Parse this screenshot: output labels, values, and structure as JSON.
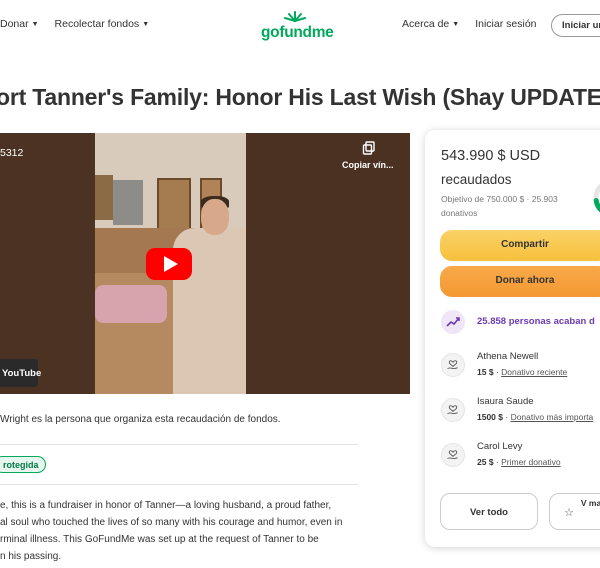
{
  "header": {
    "nav_left": [
      {
        "label": "Donar"
      },
      {
        "label": "Recolectar fondos"
      }
    ],
    "logo_text": "gofundme",
    "nav_right": [
      {
        "label": "Acerca de"
      },
      {
        "label": "Iniciar sesión"
      }
    ],
    "start_button": "Iniciar una"
  },
  "campaign": {
    "title": "ort Tanner's Family: Honor His Last Wish (Shay UPDATE",
    "video": {
      "label": "5312",
      "copy_label": "Copiar vín...",
      "youtube_badge": "YouTube"
    },
    "organizer_text": "Wright es la persona que organiza esta recaudación de fondos.",
    "protected_badge": "rotegida",
    "description": [
      "e, this is a fundraiser in honor of Tanner—a loving husband, a proud father,",
      "al soul who touched the lives of so many with his courage and humor, even in",
      "rminal illness. This GoFundMe was set up at the request of Tanner to be",
      "n his passing."
    ]
  },
  "donation_card": {
    "amount_raised": "543.990 $ USD",
    "raised_label": "recaudados",
    "goal_text": "Objetivo de 750.000 $ · 25.903 donativos",
    "progress_fraction": 0.725,
    "accent_color": "#02a95c",
    "share_button": "Compartir",
    "donate_button": "Donar ahora",
    "trend_icon": "trending-up-icon",
    "trend_text": "25.858 personas acaban d",
    "donors": [
      {
        "name": "Athena Newell",
        "amount": "15 $",
        "tag": "Donativo reciente"
      },
      {
        "name": "Isaura Saude",
        "amount": "1500 $",
        "tag": "Donativo más importa"
      },
      {
        "name": "Carol Levy",
        "amount": "25 $",
        "tag": "Primer donativo"
      }
    ],
    "see_all_button": "Ver todo",
    "top_button_label": "V ma don"
  }
}
